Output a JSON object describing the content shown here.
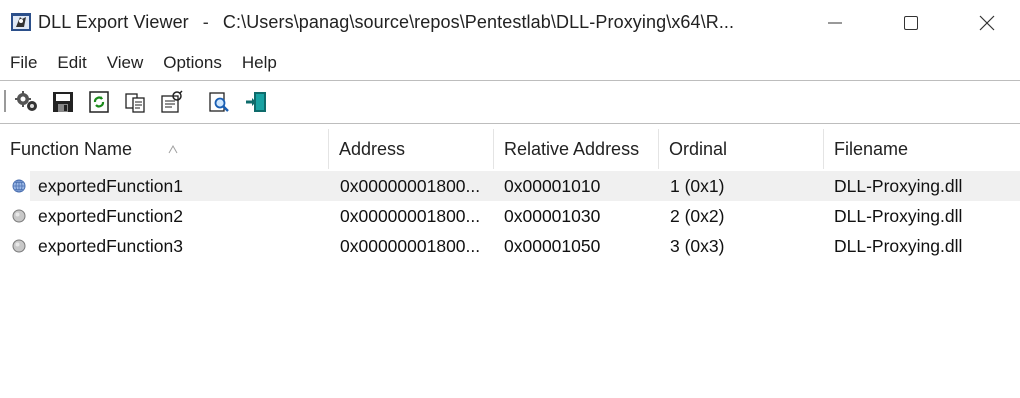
{
  "window": {
    "app_name": "DLL Export Viewer",
    "separator": "-",
    "path": "C:\\Users\\panag\\source\\repos\\Pentestlab\\DLL-Proxying\\x64\\R..."
  },
  "menu": {
    "items": [
      {
        "label": "File"
      },
      {
        "label": "Edit"
      },
      {
        "label": "View"
      },
      {
        "label": "Options"
      },
      {
        "label": "Help"
      }
    ]
  },
  "toolbar": {
    "buttons": [
      {
        "icon": "properties-gear-icon"
      },
      {
        "icon": "save-icon"
      },
      {
        "icon": "refresh-icon"
      },
      {
        "icon": "copy-icon"
      },
      {
        "icon": "html-report-icon"
      },
      {
        "icon": "find-icon"
      },
      {
        "icon": "exit-icon"
      }
    ]
  },
  "table": {
    "columns": [
      {
        "label": "Function Name"
      },
      {
        "label": "Address"
      },
      {
        "label": "Relative Address"
      },
      {
        "label": "Ordinal"
      },
      {
        "label": "Filename"
      }
    ],
    "rows": [
      {
        "function": "exportedFunction1",
        "address": "0x00000001800...",
        "relative": "0x00001010",
        "ordinal": "1 (0x1)",
        "filename": "DLL-Proxying.dll",
        "icon": "globe-icon",
        "selected": true
      },
      {
        "function": "exportedFunction2",
        "address": "0x00000001800...",
        "relative": "0x00001030",
        "ordinal": "2 (0x2)",
        "filename": "DLL-Proxying.dll",
        "icon": "gray-circle-icon",
        "selected": false
      },
      {
        "function": "exportedFunction3",
        "address": "0x00000001800...",
        "relative": "0x00001050",
        "ordinal": "3 (0x3)",
        "filename": "DLL-Proxying.dll",
        "icon": "gray-circle-icon",
        "selected": false
      }
    ]
  },
  "colors": {
    "selection": "#f0f0f0",
    "separator": "#bdbdbd"
  }
}
